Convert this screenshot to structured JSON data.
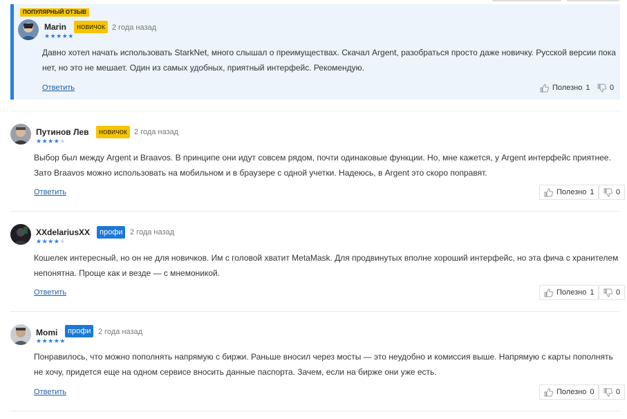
{
  "colors": {
    "accent": "#2a7de1",
    "novice_badge": "#f6c400",
    "pro_badge": "#1a78d9",
    "featured_bg": "#eef4fb"
  },
  "featured_label": "ПОПУЛЯРНЫЙ ОТЗЫВ",
  "reviews": [
    {
      "author": "Marin",
      "level": "новичок",
      "time": "2 года назад",
      "rating": 5,
      "text": "Давно хотел начать использовать StarkNet, много слышал о преимуществах. Скачал Argent, разобраться просто даже новичку. Русской версии пока нет, но это не мешает. Один из самых удобных, приятный интерфейс. Рекомендую.",
      "reply": "Ответить",
      "helpful_label": "Полезно",
      "helpful_count": "1",
      "unhelpful_count": "0"
    },
    {
      "author": "Путинов Лев",
      "level": "новичок",
      "time": "2 года назад",
      "rating": 4,
      "text": "Выбор был между Argent и Braavos. В принципе они идут совсем рядом, почти одинаковые функции. Но, мне кажется, у Argent интерфейс приятнее. Зато Braavos можно использовать на мобильном и в браузере с одной учетки. Надеюсь, в Argent это скоро поправят.",
      "reply": "Ответить",
      "helpful_label": "Полезно",
      "helpful_count": "1",
      "unhelpful_count": "0"
    },
    {
      "author": "XXdelariusXX",
      "level": "профи",
      "time": "2 года назад",
      "rating": 4,
      "text": "Кошелек интересный, но он не для новичков. Им с головой хватит MetaMask. Для продвинутых вполне хороший интерфейс, но эта фича с хранителем непонятна. Проще как и везде — с мнемоникой.",
      "reply": "Ответить",
      "helpful_label": "Полезно",
      "helpful_count": "1",
      "unhelpful_count": "0"
    },
    {
      "author": "Momi",
      "level": "профи",
      "time": "2 года назад",
      "rating": 5,
      "text": "Понравилось, что можно пополнять напрямую с биржи. Раньше вносил через мосты — это неудобно и комиссия выше. Напрямую с карты пополнять не хочу, придется еще на одном сервисе вносить данные паспорта. Зачем, если на бирже они уже есть.",
      "reply": "Ответить",
      "helpful_label": "Полезно",
      "helpful_count": "0",
      "unhelpful_count": "0"
    }
  ]
}
